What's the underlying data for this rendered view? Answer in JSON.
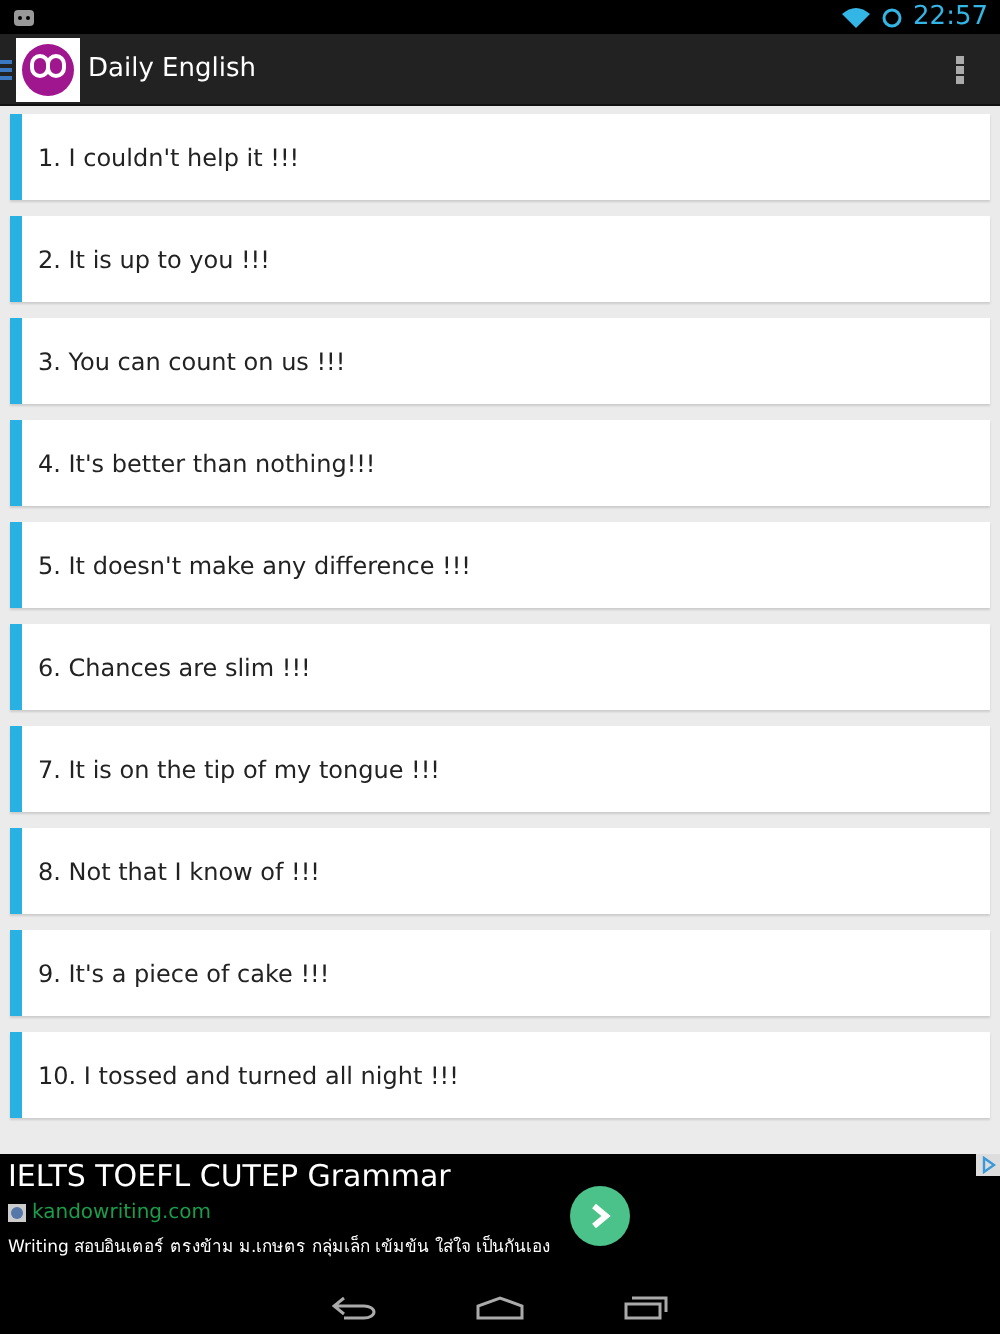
{
  "status_bar": {
    "time": "22:57"
  },
  "action_bar": {
    "title": "Daily English"
  },
  "phrases": [
    "1. I couldn't help it !!!",
    "2. It is up to you !!!",
    "3. You can count on us !!!",
    "4. It's better than nothing!!!",
    "5. It doesn't make any difference !!!",
    "6. Chances are slim !!!",
    "7. It is on the tip of my tongue !!!",
    "8. Not that I know of !!!",
    "9. It's a piece of cake !!!",
    "10. I tossed and turned all night !!!"
  ],
  "ad": {
    "headline": "IELTS TOEFL CUTEP Grammar",
    "url": "kandowriting.com",
    "description": "Writing สอบอินเตอร์ ตรงข้าม ม.เกษตร กลุ่มเล็ก เข้มข้น ใส่ใจ เป็นกันเอง"
  }
}
